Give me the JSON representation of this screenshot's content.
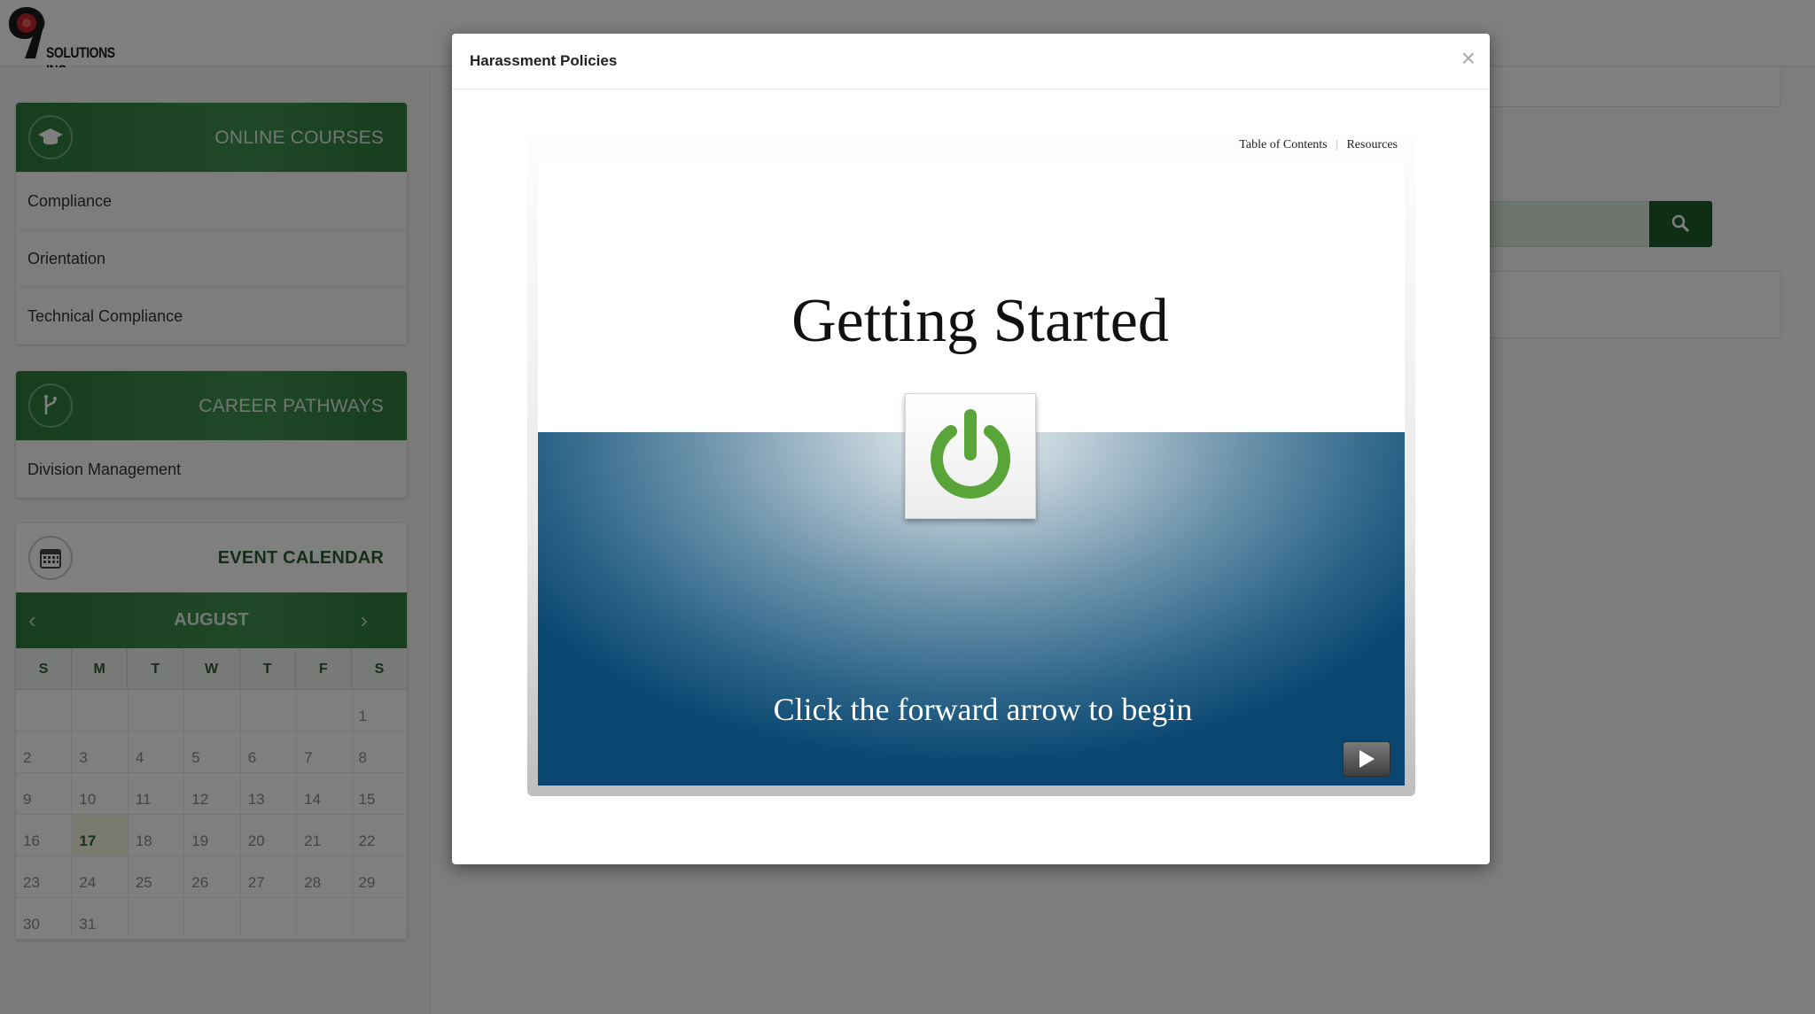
{
  "brand": {
    "logo_text": "SOLUTIONS INC."
  },
  "sidebar": {
    "online_courses": {
      "title": "ONLINE COURSES",
      "icon": "graduation-cap-icon",
      "items": [
        {
          "label": "Compliance"
        },
        {
          "label": "Orientation"
        },
        {
          "label": "Technical Compliance"
        }
      ]
    },
    "career_pathways": {
      "title": "CAREER PATHWAYS",
      "icon": "branch-icon",
      "items": [
        {
          "label": "Division Management"
        }
      ]
    },
    "event_calendar": {
      "title": "EVENT CALENDAR",
      "icon": "calendar-icon",
      "month": "AUGUST",
      "prev_glyph": "‹",
      "next_glyph": "›",
      "weekdays": [
        "S",
        "M",
        "T",
        "W",
        "T",
        "F",
        "S"
      ],
      "weeks": [
        [
          "",
          "",
          "",
          "",
          "",
          "",
          "1"
        ],
        [
          "2",
          "3",
          "4",
          "5",
          "6",
          "7",
          "8"
        ],
        [
          "9",
          "10",
          "11",
          "12",
          "13",
          "14",
          "15"
        ],
        [
          "16",
          "17",
          "18",
          "19",
          "20",
          "21",
          "22"
        ],
        [
          "23",
          "24",
          "25",
          "26",
          "27",
          "28",
          "29"
        ],
        [
          "30",
          "31",
          "",
          "",
          "",
          "",
          ""
        ]
      ],
      "today": "17"
    }
  },
  "modal": {
    "title": "Harassment Policies",
    "close_glyph": "×",
    "player": {
      "links": [
        "Table of Contents",
        "Resources"
      ],
      "link_separator": "|",
      "slide_title": "Getting Started",
      "slide_subtitle": "Click the forward arrow to begin"
    }
  },
  "colors": {
    "brand_green": "#3f9151",
    "dark_green": "#1d5d2a",
    "slide_blue": "#094670",
    "power_green": "#5aa53a",
    "logo_red": "#c0272d"
  }
}
